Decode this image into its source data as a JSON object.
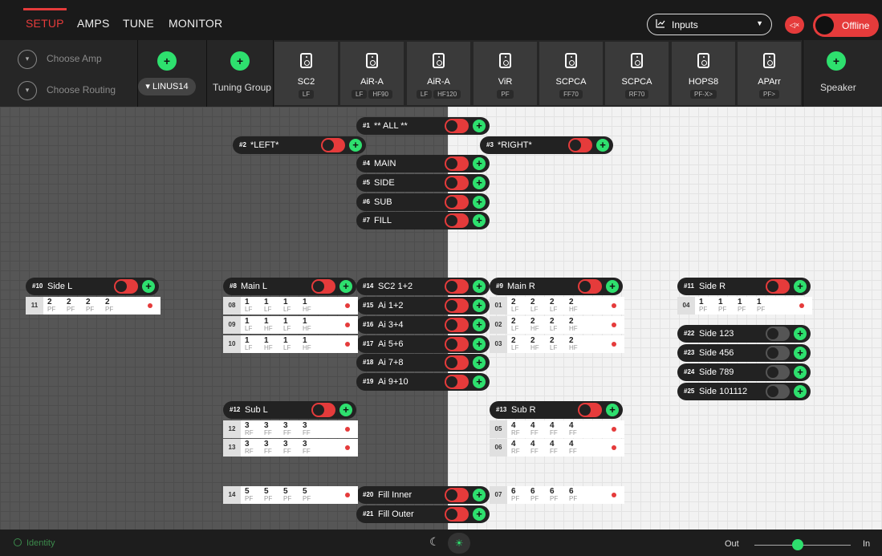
{
  "nav": {
    "tabs": [
      "SETUP",
      "AMPS",
      "TUNE",
      "MONITOR"
    ],
    "inputs_label": "Inputs",
    "offline_label": "Offline"
  },
  "toolbar": {
    "choose_amp": "Choose Amp",
    "choose_routing": "Choose Routing",
    "linus_label": "LINUS14",
    "tuning_group": "Tuning Group",
    "speaker_label": "Speaker",
    "speakers": [
      {
        "name": "SC2",
        "subs": [
          "LF"
        ]
      },
      {
        "name": "AiR-A",
        "subs": [
          "LF",
          "HF90"
        ]
      },
      {
        "name": "AiR-A",
        "subs": [
          "LF",
          "HF120"
        ]
      },
      {
        "name": "ViR",
        "subs": [
          "PF"
        ]
      },
      {
        "name": "SCPCA",
        "subs": [
          "FF70"
        ]
      },
      {
        "name": "SCPCA",
        "subs": [
          "RF70"
        ]
      },
      {
        "name": "HOPS8",
        "subs": [
          "PF-X>"
        ]
      },
      {
        "name": "APArr",
        "subs": [
          "PF>"
        ]
      }
    ]
  },
  "groups": {
    "g1": {
      "num": "#1",
      "label": "** ALL **"
    },
    "g2": {
      "num": "#2",
      "label": "*LEFT*"
    },
    "g3": {
      "num": "#3",
      "label": "*RIGHT*"
    },
    "g4": {
      "num": "#4",
      "label": "MAIN"
    },
    "g5": {
      "num": "#5",
      "label": "SIDE"
    },
    "g6": {
      "num": "#6",
      "label": "SUB"
    },
    "g7": {
      "num": "#7",
      "label": "FILL"
    },
    "g8": {
      "num": "#8",
      "label": "Main L"
    },
    "g9": {
      "num": "#9",
      "label": "Main R"
    },
    "g10": {
      "num": "#10",
      "label": "Side L"
    },
    "g11": {
      "num": "#11",
      "label": "Side R"
    },
    "g12": {
      "num": "#12",
      "label": "Sub L"
    },
    "g13": {
      "num": "#13",
      "label": "Sub R"
    },
    "g14": {
      "num": "#14",
      "label": "SC2 1+2"
    },
    "g15": {
      "num": "#15",
      "label": "Ai 1+2"
    },
    "g16": {
      "num": "#16",
      "label": "Ai 3+4"
    },
    "g17": {
      "num": "#17",
      "label": "Ai 5+6"
    },
    "g18": {
      "num": "#18",
      "label": "Ai 7+8"
    },
    "g19": {
      "num": "#19",
      "label": "Ai 9+10"
    },
    "g20": {
      "num": "#20",
      "label": "Fill Inner"
    },
    "g21": {
      "num": "#21",
      "label": "Fill Outer"
    },
    "g22": {
      "num": "#22",
      "label": "Side 123"
    },
    "g23": {
      "num": "#23",
      "label": "Side 456"
    },
    "g24": {
      "num": "#24",
      "label": "Side 789"
    },
    "g25": {
      "num": "#25",
      "label": "Side 101112"
    }
  },
  "amps": {
    "a11": {
      "id": "11",
      "n": [
        "2",
        "2",
        "2",
        "2"
      ],
      "t": [
        "PF",
        "PF",
        "PF",
        "PF"
      ]
    },
    "a08": {
      "id": "08",
      "n": [
        "1",
        "1",
        "1",
        "1"
      ],
      "t": [
        "LF",
        "LF",
        "LF",
        "HF"
      ]
    },
    "a09": {
      "id": "09",
      "n": [
        "1",
        "1",
        "1",
        "1"
      ],
      "t": [
        "LF",
        "HF",
        "LF",
        "HF"
      ]
    },
    "a10": {
      "id": "10",
      "n": [
        "1",
        "1",
        "1",
        "1"
      ],
      "t": [
        "LF",
        "HF",
        "LF",
        "HF"
      ]
    },
    "a01": {
      "id": "01",
      "n": [
        "2",
        "2",
        "2",
        "2"
      ],
      "t": [
        "LF",
        "LF",
        "LF",
        "HF"
      ]
    },
    "a02": {
      "id": "02",
      "n": [
        "2",
        "2",
        "2",
        "2"
      ],
      "t": [
        "LF",
        "HF",
        "LF",
        "HF"
      ]
    },
    "a03": {
      "id": "03",
      "n": [
        "2",
        "2",
        "2",
        "2"
      ],
      "t": [
        "LF",
        "HF",
        "LF",
        "HF"
      ]
    },
    "a04": {
      "id": "04",
      "n": [
        "1",
        "1",
        "1",
        "1"
      ],
      "t": [
        "PF",
        "PF",
        "PF",
        "PF"
      ]
    },
    "a12": {
      "id": "12",
      "n": [
        "3",
        "3",
        "3",
        "3"
      ],
      "t": [
        "RF",
        "FF",
        "FF",
        "FF"
      ]
    },
    "a13": {
      "id": "13",
      "n": [
        "3",
        "3",
        "3",
        "3"
      ],
      "t": [
        "RF",
        "FF",
        "FF",
        "FF"
      ]
    },
    "a05": {
      "id": "05",
      "n": [
        "4",
        "4",
        "4",
        "4"
      ],
      "t": [
        "RF",
        "FF",
        "FF",
        "FF"
      ]
    },
    "a06": {
      "id": "06",
      "n": [
        "4",
        "4",
        "4",
        "4"
      ],
      "t": [
        "RF",
        "FF",
        "FF",
        "FF"
      ]
    },
    "a14": {
      "id": "14",
      "n": [
        "5",
        "5",
        "5",
        "5"
      ],
      "t": [
        "PF",
        "PF",
        "PF",
        "PF"
      ]
    },
    "a07": {
      "id": "07",
      "n": [
        "6",
        "6",
        "6",
        "6"
      ],
      "t": [
        "PF",
        "PF",
        "PF",
        "PF"
      ]
    }
  },
  "footer": {
    "identity": "Identity",
    "out": "Out",
    "in": "In",
    "out_in_level": 0.45
  },
  "colors": {
    "accent": "#e53b3b",
    "add": "#2ee06e"
  }
}
